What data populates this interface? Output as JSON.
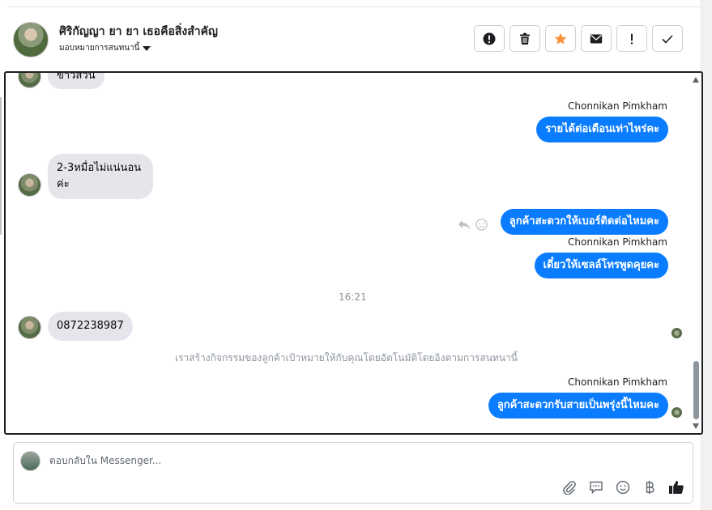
{
  "header": {
    "contact_name": "ศิริกัญญา ยา ยา เธอคือสิ่งสำคัญ",
    "assign_label": "มอบหมายการสนทนานี้"
  },
  "toolbar": [
    {
      "name": "report-spam",
      "icon": "alert-circle-icon"
    },
    {
      "name": "delete",
      "icon": "trash-icon"
    },
    {
      "name": "star",
      "icon": "star-icon",
      "color": "#f7923a"
    },
    {
      "name": "mark-unread",
      "icon": "envelope-icon"
    },
    {
      "name": "follow-up",
      "icon": "exclamation-icon"
    },
    {
      "name": "mark-done",
      "icon": "check-icon"
    }
  ],
  "messages": {
    "m0_partial": "ข้าวสวน",
    "m1_sender": "Chonnikan Pimkham",
    "m1_text": "รายได้ต่อเดือนเท่าไหร่คะ",
    "m2_text": "2-3หมื่อไม่แน่นอนค่ะ",
    "m3_text": "ลูกค้าสะดวกให้เบอร์ติดต่อไหมคะ",
    "m4_sender": "Chonnikan Pimkham",
    "m4_text": "เดี๋ยวให้เซลล์โทรพูดคุยคะ",
    "time_divider": "16:21",
    "m5_text": "0872238987",
    "system_notice": "เราสร้างกิจกรรมของลูกค้าเป้าหมายให้กับคุณโดยอัตโนมัติโดยอิงตามการสนทนานี้",
    "m6_sender": "Chonnikan Pimkham",
    "m6_text": "ลูกค้าสะดวกรับสายเป็นพรุ่งนี้ไหมคะ"
  },
  "composer": {
    "placeholder": "ตอบกลับใน Messenger...",
    "tools": [
      "paperclip-icon",
      "saved-reply-icon",
      "emoji-icon",
      "baht-icon",
      "thumbs-up-icon"
    ]
  },
  "colors": {
    "outgoing_bubble": "#0a7cff",
    "incoming_bubble": "#e4e6eb",
    "star": "#f7923a"
  }
}
